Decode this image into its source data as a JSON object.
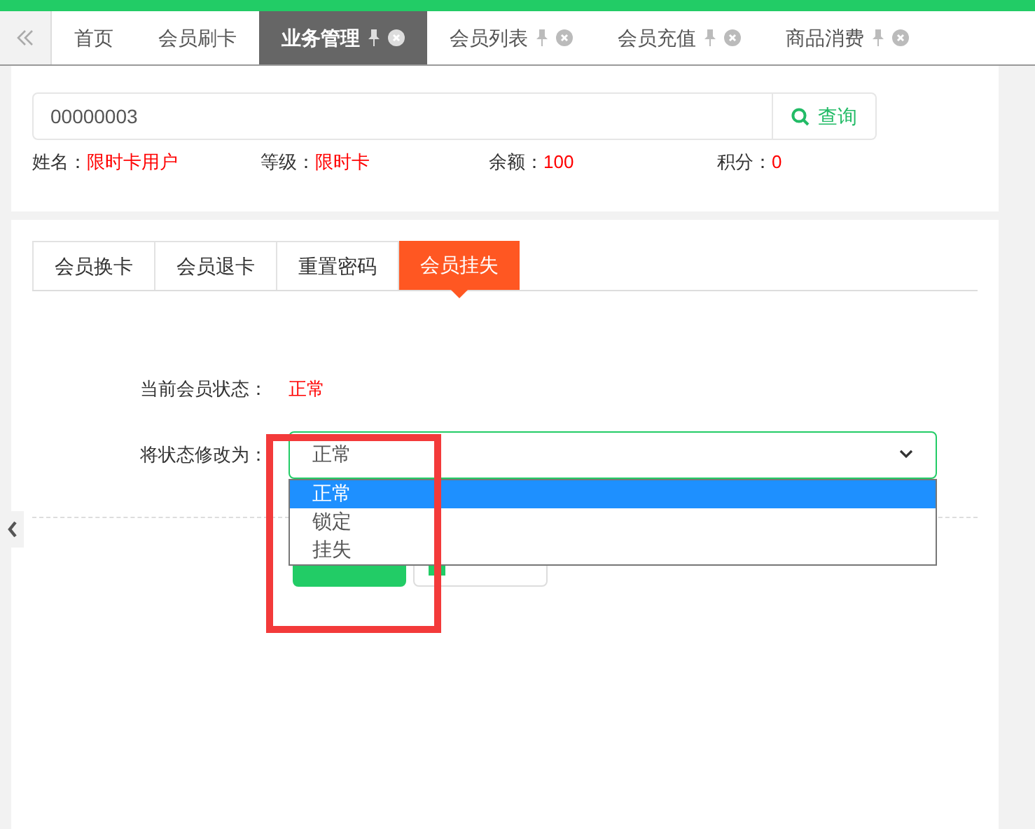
{
  "page_tabs": [
    {
      "label": "首页",
      "selected": false,
      "pinnable": false
    },
    {
      "label": "会员刷卡",
      "selected": false,
      "pinnable": false
    },
    {
      "label": "业务管理",
      "selected": true,
      "pinnable": true
    },
    {
      "label": "会员列表",
      "selected": false,
      "pinnable": true
    },
    {
      "label": "会员充值",
      "selected": false,
      "pinnable": true
    },
    {
      "label": "商品消费",
      "selected": false,
      "pinnable": true
    }
  ],
  "search": {
    "value": "00000003",
    "button": "查询"
  },
  "member_info": [
    {
      "label": "姓名：",
      "value": "限时卡用户"
    },
    {
      "label": "等级：",
      "value": "限时卡"
    },
    {
      "label": "余额：",
      "value": "100"
    },
    {
      "label": "积分：",
      "value": "0"
    }
  ],
  "action_tabs": [
    {
      "label": "会员换卡",
      "selected": false
    },
    {
      "label": "会员退卡",
      "selected": false
    },
    {
      "label": "重置密码",
      "selected": false
    },
    {
      "label": "会员挂失",
      "selected": true
    }
  ],
  "current_status": {
    "label": "当前会员状态：",
    "value": "正常"
  },
  "change_status": {
    "label": "将状态修改为：",
    "value": "正常",
    "expanded": true,
    "options": [
      {
        "label": "正常",
        "selected": true
      },
      {
        "label": "锁定",
        "selected": false
      },
      {
        "label": "挂失",
        "selected": false
      }
    ]
  }
}
